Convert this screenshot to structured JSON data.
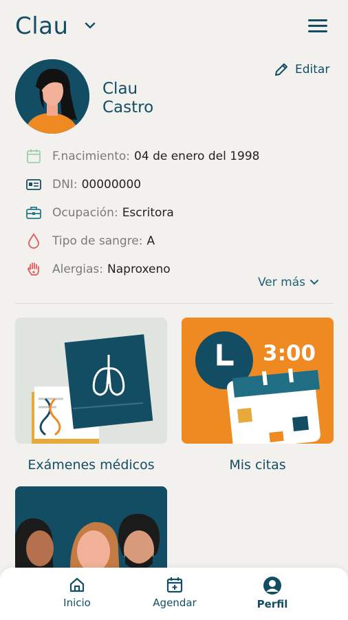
{
  "header": {
    "title": "Clau"
  },
  "profile": {
    "first_name": "Clau",
    "last_name": "Castro",
    "edit_label": "Editar"
  },
  "info": [
    {
      "label": "F.nacimiento:",
      "value": "04 de enero del 1998",
      "icon": "calendar-icon"
    },
    {
      "label": "DNI:",
      "value": "00000000",
      "icon": "id-card-icon"
    },
    {
      "label": "Ocupación:",
      "value": "Escritora",
      "icon": "briefcase-icon"
    },
    {
      "label": "Tipo de sangre:",
      "value": "A",
      "icon": "blood-drop-icon"
    },
    {
      "label": "Alergias:",
      "value": "Naproxeno",
      "icon": "hand-icon"
    }
  ],
  "see_more": "Ver más",
  "cards": [
    {
      "label": "Exámenes médicos"
    },
    {
      "label": "Mis citas",
      "clock_time": "3:00"
    },
    {
      "label": ""
    }
  ],
  "nav": [
    {
      "label": "Inicio",
      "icon": "home-icon"
    },
    {
      "label": "Agendar",
      "icon": "calendar-plus-icon"
    },
    {
      "label": "Perfil",
      "icon": "user-circle-icon"
    }
  ],
  "colors": {
    "primary": "#134d63",
    "accent": "#ef8a22",
    "background": "#f3f1ee"
  }
}
